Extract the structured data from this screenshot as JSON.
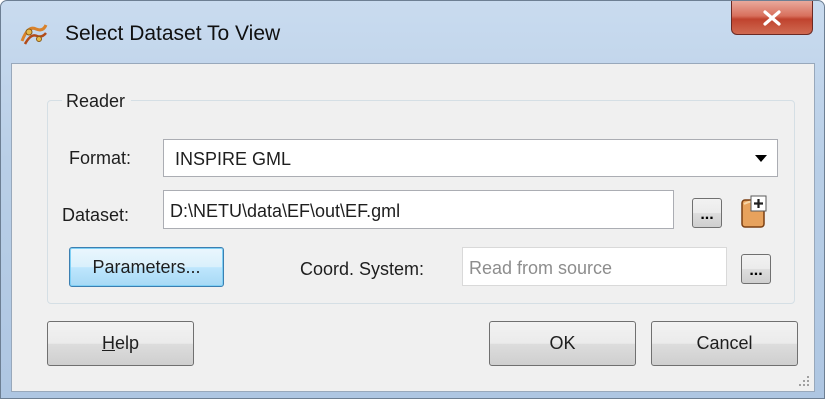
{
  "window": {
    "title": "Select Dataset To View",
    "close_symbol": "X",
    "title_icon": "fme-workbench-icon"
  },
  "reader": {
    "group_label": "Reader",
    "format_label": "Format:",
    "format_value": "INSPIRE GML",
    "dataset_label": "Dataset:",
    "dataset_value": "D:\\NETU\\data\\EF\\out\\EF.gml",
    "browse_symbol": "...",
    "add_dataset_icon": "add-file-icon",
    "parameters_label": "Parameters...",
    "coord_system_label": "Coord. System:",
    "coord_system_placeholder": "Read from source",
    "coord_browse_symbol": "..."
  },
  "footer": {
    "help_mnemonic": "H",
    "help_rest": "elp",
    "ok_label": "OK",
    "cancel_label": "Cancel"
  },
  "colors": {
    "frame": "#b9cfe7",
    "client": "#f0f0f0",
    "close_button": "#c0432e",
    "focused_button": "#bee6fd"
  }
}
